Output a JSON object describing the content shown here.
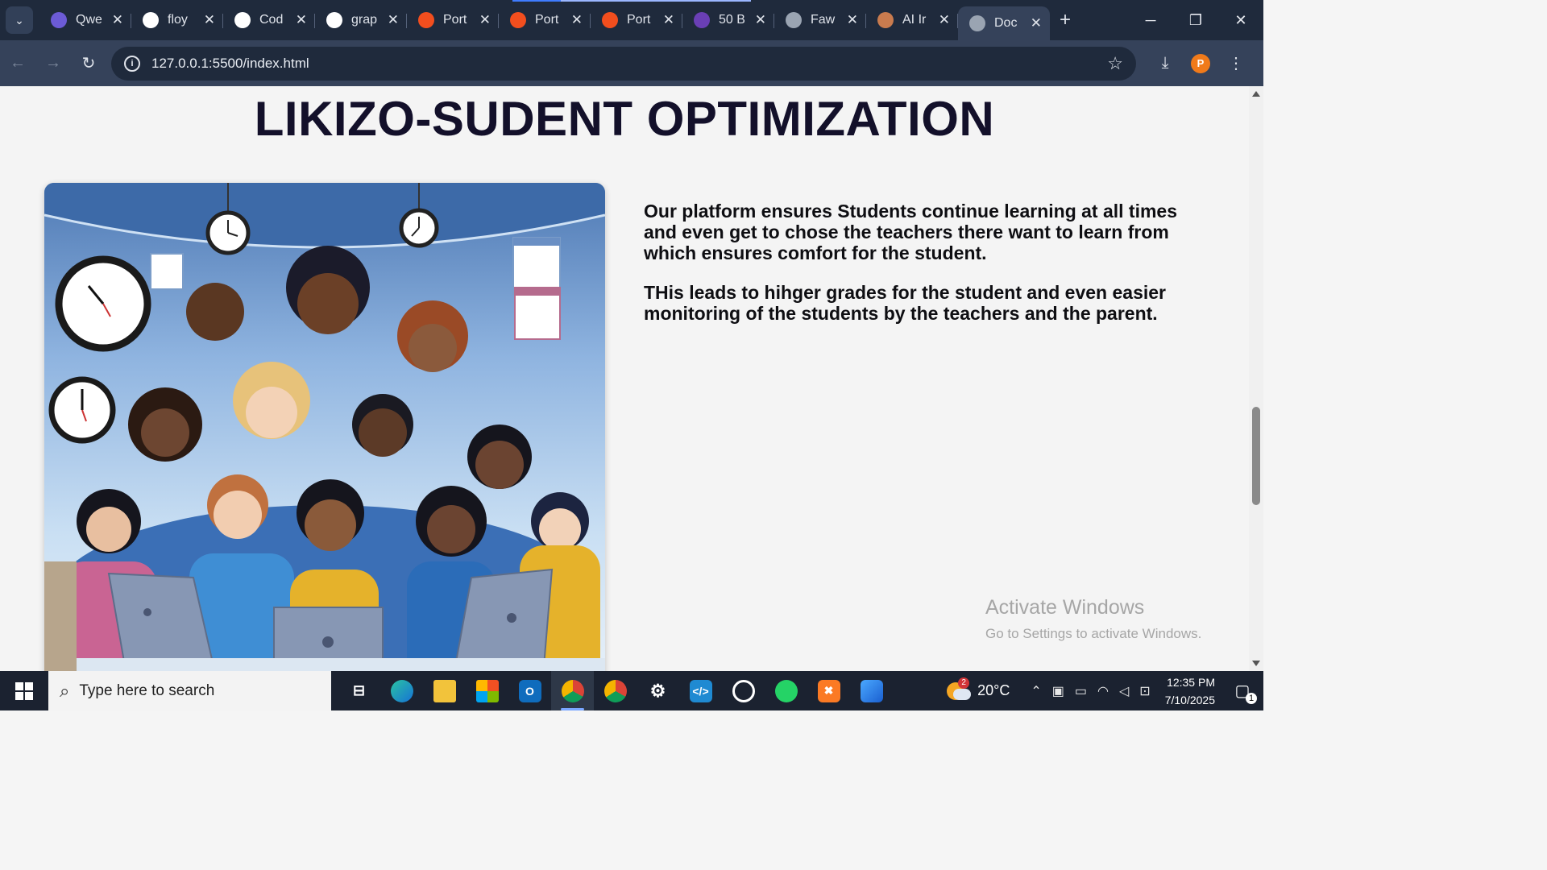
{
  "browser": {
    "tabs": [
      {
        "label": "Qwe",
        "favicon": "qwen-icon",
        "color": "#6c5bd6"
      },
      {
        "label": "floy",
        "favicon": "google-icon",
        "color": "#ffffff"
      },
      {
        "label": "Cod",
        "favicon": "codepen-icon",
        "color": "#ffffff"
      },
      {
        "label": "grap",
        "favicon": "google-icon",
        "color": "#ffffff"
      },
      {
        "label": "Port",
        "favicon": "figma-icon",
        "color": "#f24e1e"
      },
      {
        "label": "Port",
        "favicon": "figma-icon",
        "color": "#f24e1e"
      },
      {
        "label": "Port",
        "favicon": "figma-icon",
        "color": "#f24e1e"
      },
      {
        "label": "50 B",
        "favicon": "colorlib-icon",
        "color": "#6a3fb5"
      },
      {
        "label": "Faw",
        "favicon": "globe-icon",
        "color": "#9aa4b2"
      },
      {
        "label": "AI Ir",
        "favicon": "ai-avatar-icon",
        "color": "#c97b4e"
      },
      {
        "label": "Doc",
        "favicon": "globe-icon",
        "color": "#9aa4b2",
        "active": true
      }
    ],
    "url": "127.0.0.1:5500/index.html",
    "profile_initial": "P",
    "accent": "#f07a1a"
  },
  "page": {
    "title": "LIKIZO-SUDENT OPTIMIZATION",
    "paragraphs": [
      "Our platform ensures Students continue learning at all times and even get to chose the teachers there want to learn from which ensures comfort for the student.",
      "THis leads to hihger grades for the student and even easier monitoring of the students by the teachers and the parent."
    ]
  },
  "watermark": {
    "line1": "Activate Windows",
    "line2": "Go to Settings to activate Windows."
  },
  "taskbar": {
    "search_placeholder": "Type here to search",
    "weather_temp": "20°C",
    "weather_badge": "2",
    "time": "12:35 PM",
    "date": "7/10/2025",
    "notification_count": "1"
  }
}
